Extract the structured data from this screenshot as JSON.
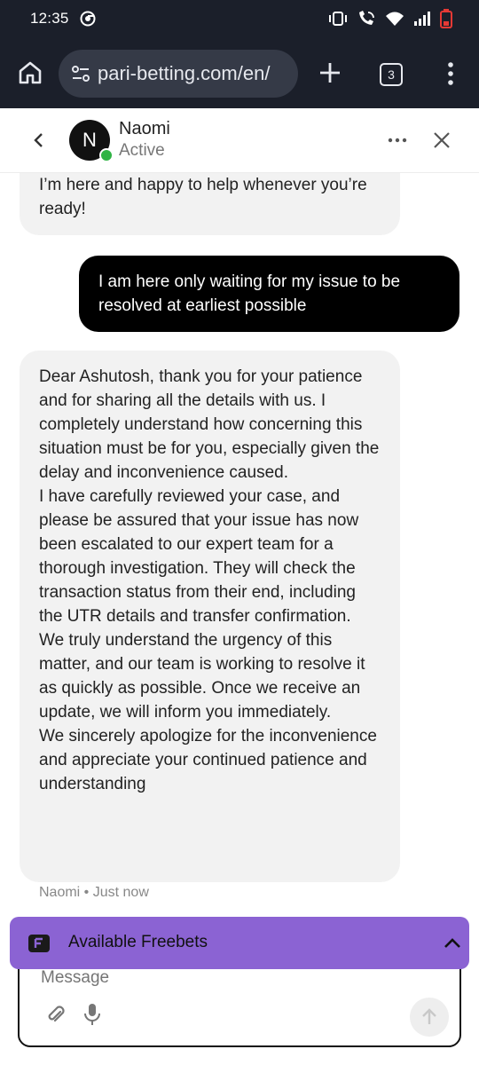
{
  "status_bar": {
    "time": "12:35"
  },
  "browser": {
    "url": "pari-betting.com/en/",
    "tab_count": "3"
  },
  "chat": {
    "agent": {
      "initial": "N",
      "name": "Naomi",
      "status": "Active"
    },
    "messages": [
      {
        "from": "agent",
        "lines": [
          "I’m here and happy to help whenever you’re ready!"
        ]
      },
      {
        "from": "user",
        "text": "I am here only waiting for my issue to be resolved at earliest possible"
      },
      {
        "from": "agent",
        "lines": [
          "Dear Ashutosh, thank you for your patience and for sharing all the details with us. I completely understand how concerning this situation must be for you, especially given the delay and inconvenience caused.",
          "I have carefully reviewed your case, and please be assured that your issue has now been escalated to our expert team for a thorough investigation. They will check the transaction status from their end, including the UTR details and transfer confirmation.",
          "We truly understand the urgency of this matter, and our team is working to resolve it as quickly as possible. Once we receive an update, we will inform you immediately.",
          "We sincerely apologize for the inconvenience and appreciate your continued patience and understanding"
        ]
      }
    ],
    "last_meta": "Naomi • Just now"
  },
  "freebets": {
    "label": "Available Freebets"
  },
  "composer": {
    "placeholder": "Message"
  },
  "colors": {
    "system_bar": "#1b1f2a",
    "url_pill": "#353a47",
    "agent_bubble": "#f2f2f2",
    "user_bubble": "#000000",
    "freebets_bg": "#8b63d3",
    "online_dot": "#2fb344"
  },
  "icons": {
    "status_left": "chrome-icon",
    "status_right": [
      "vibrate-icon",
      "wifi-call-icon",
      "wifi-icon",
      "signal-icon",
      "battery-icon"
    ],
    "browser": [
      "home-icon",
      "site-settings-icon",
      "new-tab-icon",
      "tab-switcher-icon",
      "overflow-menu-icon"
    ],
    "chat": [
      "back-chevron-icon",
      "more-dots-icon",
      "close-icon",
      "freebets-ticket-icon",
      "chevron-up-icon",
      "attach-icon",
      "mic-icon",
      "send-arrow-icon"
    ]
  }
}
